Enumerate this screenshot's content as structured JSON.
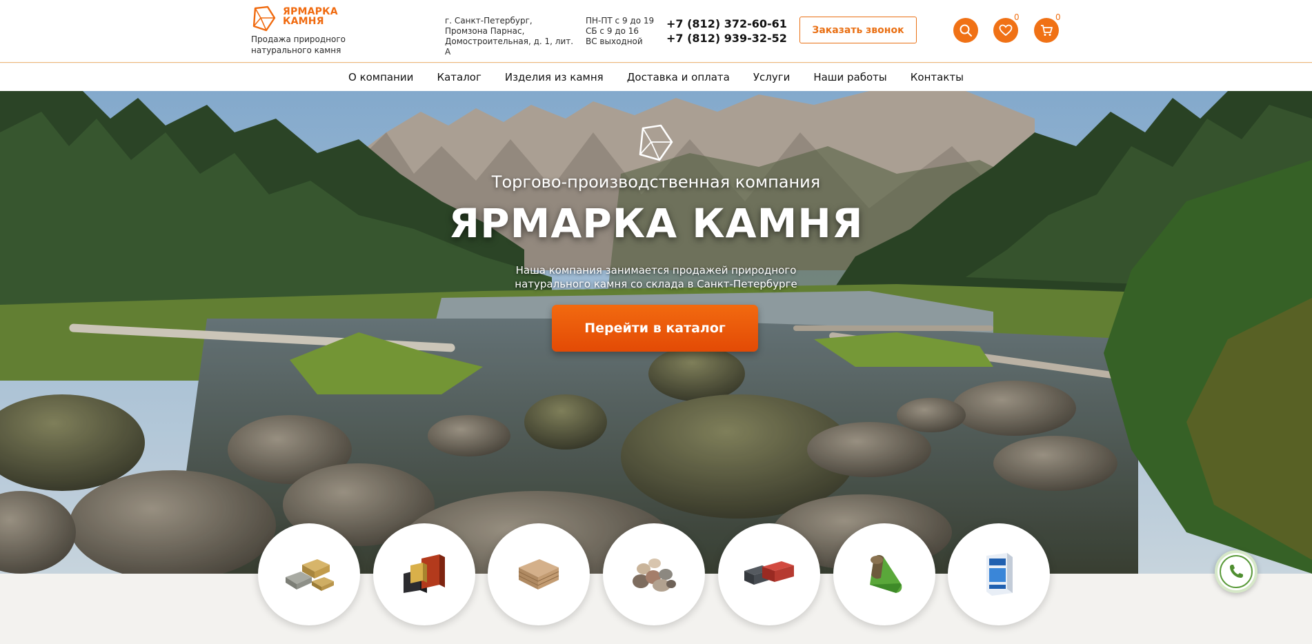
{
  "brand": {
    "name_line1": "ЯРМАРКА",
    "name_line2": "КАМНЯ",
    "tagline": "Продажа природного натурального камня",
    "accent": "#f06a0f"
  },
  "contacts": {
    "address_line1": "г. Санкт-Петербург,",
    "address_line2": "Промзона Парнас,",
    "address_line3": "Домостроительная, д. 1, лит. А",
    "hours_line1": "ПН-ПТ с 9 до 19",
    "hours_line2": "СБ с 9 до 16",
    "hours_line3": "ВС выходной",
    "phone1": "+7 (812) 372-60-61",
    "phone2": "+7 (812) 939-32-52",
    "callback_label": "Заказать звонок"
  },
  "header_icons": {
    "search_icon": "search-icon",
    "favorites_icon": "heart-icon",
    "favorites_count": "0",
    "cart_icon": "cart-icon",
    "cart_count": "0"
  },
  "nav": {
    "items": [
      "О компании",
      "Каталог",
      "Изделия из камня",
      "Доставка и оплата",
      "Услуги",
      "Наши работы",
      "Контакты"
    ]
  },
  "hero": {
    "pretitle": "Торгово-производственная компания",
    "title": "ЯРМАРКА КАМНЯ",
    "description_line1": "Наша компания занимается продажей природного",
    "description_line2": "натурального камня со склада в Санкт-Петербурге",
    "cta_label": "Перейти в каталог"
  },
  "categories": [
    {
      "icon": "stone-blocks-icon"
    },
    {
      "icon": "facing-brick-icon"
    },
    {
      "icon": "flagstone-icon"
    },
    {
      "icon": "pebbles-icon"
    },
    {
      "icon": "paving-stone-icon"
    },
    {
      "icon": "turf-roll-icon"
    },
    {
      "icon": "mix-bag-icon"
    }
  ],
  "floating": {
    "phone_icon": "phone-icon"
  }
}
